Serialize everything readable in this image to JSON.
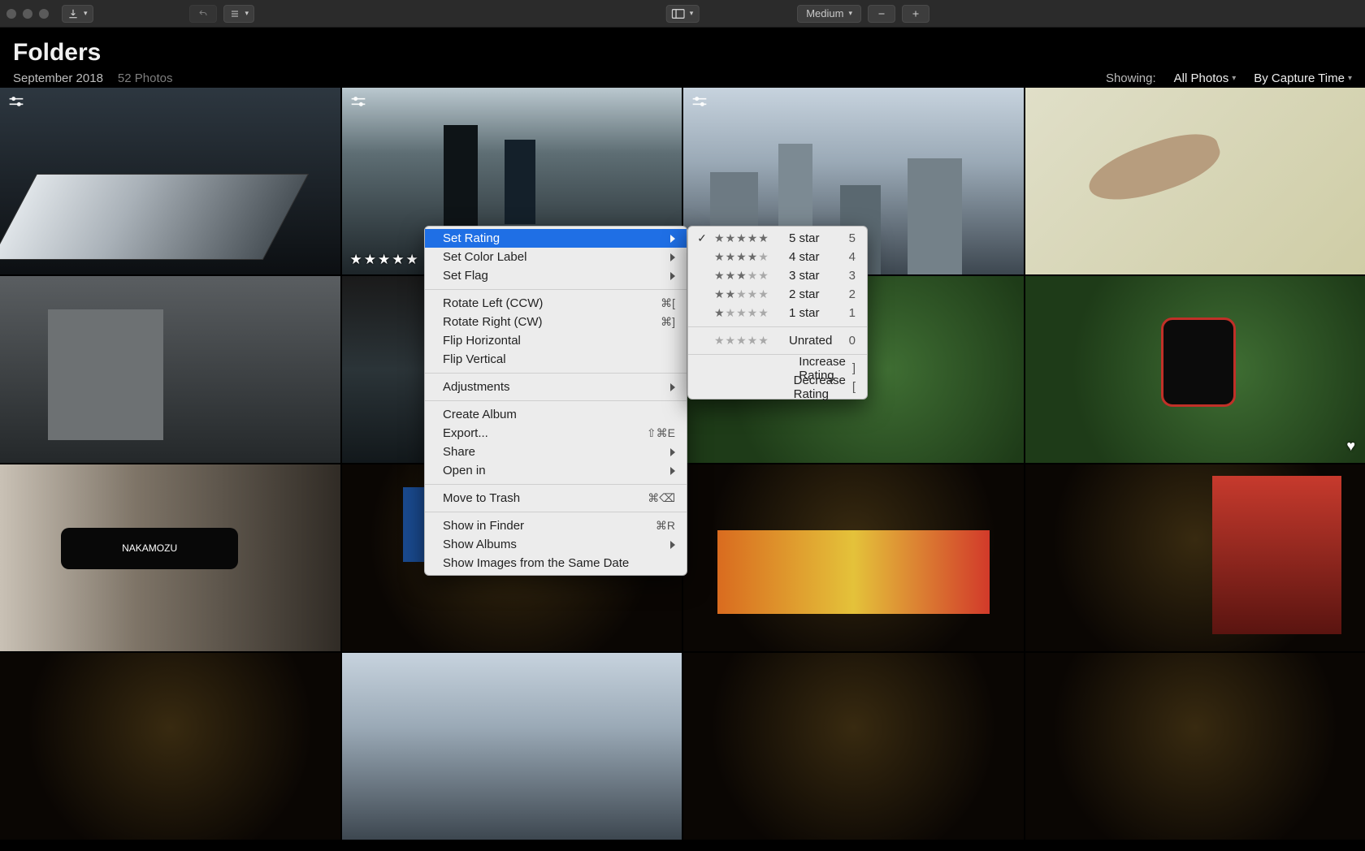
{
  "toolbar": {
    "size_label": "Medium"
  },
  "header": {
    "title": "Folders",
    "date": "September 2018",
    "count": "52 Photos",
    "showing_label": "Showing:",
    "showing_value": "All Photos",
    "sort_value": "By Capture Time"
  },
  "selected_rating_stars": "★★★★★",
  "context_menu": {
    "items": [
      {
        "label": "Set Rating",
        "submenu": true,
        "highlight": true
      },
      {
        "label": "Set Color Label",
        "submenu": true
      },
      {
        "label": "Set Flag",
        "submenu": true
      },
      {
        "sep": true
      },
      {
        "label": "Rotate Left (CCW)",
        "shortcut": "⌘["
      },
      {
        "label": "Rotate Right (CW)",
        "shortcut": "⌘]"
      },
      {
        "label": "Flip Horizontal"
      },
      {
        "label": "Flip Vertical"
      },
      {
        "sep": true
      },
      {
        "label": "Adjustments",
        "submenu": true
      },
      {
        "sep": true
      },
      {
        "label": "Create Album"
      },
      {
        "label": "Export...",
        "shortcut": "⇧⌘E"
      },
      {
        "label": "Share",
        "submenu": true
      },
      {
        "label": "Open in",
        "submenu": true
      },
      {
        "sep": true
      },
      {
        "label": "Move to Trash",
        "shortcut": "⌘⌫"
      },
      {
        "sep": true
      },
      {
        "label": "Show in Finder",
        "shortcut": "⌘R"
      },
      {
        "label": "Show Albums",
        "submenu": true
      },
      {
        "label": "Show Images from the Same Date"
      }
    ]
  },
  "rating_menu": {
    "items": [
      {
        "checked": true,
        "fill": 5,
        "label": "5 star",
        "key": "5"
      },
      {
        "checked": false,
        "fill": 4,
        "label": "4 star",
        "key": "4"
      },
      {
        "checked": false,
        "fill": 3,
        "label": "3 star",
        "key": "3"
      },
      {
        "checked": false,
        "fill": 2,
        "label": "2 star",
        "key": "2"
      },
      {
        "checked": false,
        "fill": 1,
        "label": "1 star",
        "key": "1"
      },
      {
        "sep": true
      },
      {
        "checked": false,
        "fill": 0,
        "label": "Unrated",
        "key": "0"
      },
      {
        "sep": true
      },
      {
        "plain": true,
        "label": "Increase Rating",
        "key": "]"
      },
      {
        "plain": true,
        "label": "Decrease Rating",
        "key": "["
      }
    ]
  }
}
